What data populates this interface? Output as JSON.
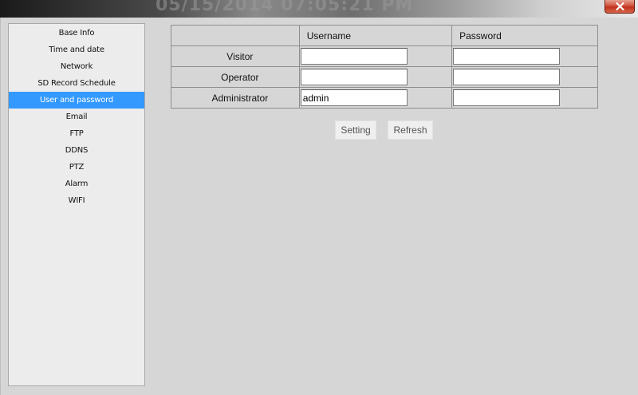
{
  "window": {
    "background_title_text": "05/15/2014 07:05:21 PM",
    "close_icon": "close-icon"
  },
  "sidebar": {
    "items": [
      {
        "label": "Base Info",
        "active": false
      },
      {
        "label": "Time and date",
        "active": false
      },
      {
        "label": "Network",
        "active": false
      },
      {
        "label": "SD Record Schedule",
        "active": false
      },
      {
        "label": "User and password",
        "active": true
      },
      {
        "label": "Email",
        "active": false
      },
      {
        "label": "FTP",
        "active": false
      },
      {
        "label": "DDNS",
        "active": false
      },
      {
        "label": "PTZ",
        "active": false
      },
      {
        "label": "Alarm",
        "active": false
      },
      {
        "label": "WIFI",
        "active": false
      }
    ],
    "active_color": "#3399ff"
  },
  "table": {
    "headers": {
      "blank": "",
      "username": "Username",
      "password": "Password"
    },
    "rows": [
      {
        "label": "Visitor",
        "username": "",
        "password": ""
      },
      {
        "label": "Operator",
        "username": "",
        "password": ""
      },
      {
        "label": "Administrator",
        "username": "admin",
        "password": ""
      }
    ]
  },
  "buttons": {
    "setting": "Setting",
    "refresh": "Refresh"
  }
}
